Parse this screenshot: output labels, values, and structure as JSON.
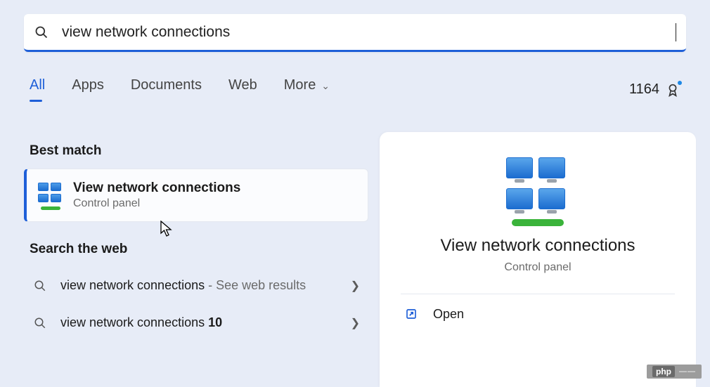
{
  "search": {
    "query": "view network connections"
  },
  "tabs": {
    "all": "All",
    "apps": "Apps",
    "documents": "Documents",
    "web": "Web",
    "more": "More"
  },
  "rewards": {
    "points": "1164"
  },
  "sections": {
    "best_match": "Best match",
    "search_web": "Search the web"
  },
  "best_match": {
    "title": "View network connections",
    "subtitle": "Control panel"
  },
  "web_results": [
    {
      "text": "view network connections",
      "suffix": " - See web results"
    },
    {
      "text": "view network connections ",
      "bold": "10"
    }
  ],
  "preview": {
    "title": "View network connections",
    "subtitle": "Control panel",
    "open": "Open"
  },
  "watermark": {
    "brand": "php",
    "rest": "——"
  }
}
